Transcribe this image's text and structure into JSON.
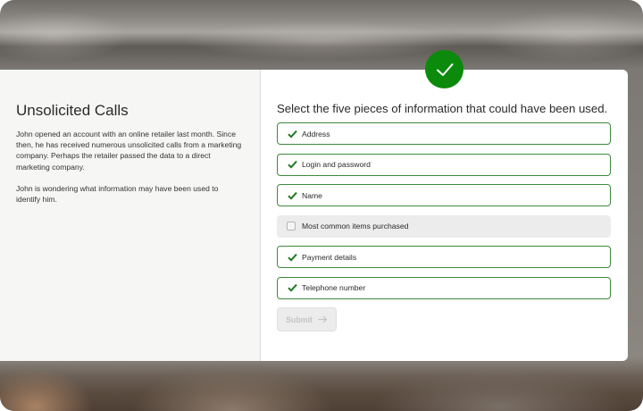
{
  "scenario": {
    "title": "Unsolicited Calls",
    "paragraph1": "John opened an account with an online retailer last month. Since then, he has received numerous unsolicited calls from a marketing company. Perhaps the retailer passed the data to a direct marketing company.",
    "paragraph2": "John is wondering what information may have been used to identify him."
  },
  "question": "Select the five pieces of information that could have been used.",
  "options": [
    {
      "label": "Address",
      "selected": true
    },
    {
      "label": "Login and password",
      "selected": true
    },
    {
      "label": "Name",
      "selected": true
    },
    {
      "label": "Most common items purchased",
      "selected": false
    },
    {
      "label": "Payment details",
      "selected": true
    },
    {
      "label": "Telephone number",
      "selected": true
    }
  ],
  "submit": {
    "label": "Submit",
    "icon": "arrow-right-icon",
    "disabled": true
  },
  "result_badge": {
    "icon": "checkmark-icon",
    "color": "#0c8a0c"
  },
  "colors": {
    "selected_border": "#3d8a3d",
    "check": "#1f7a1f"
  }
}
